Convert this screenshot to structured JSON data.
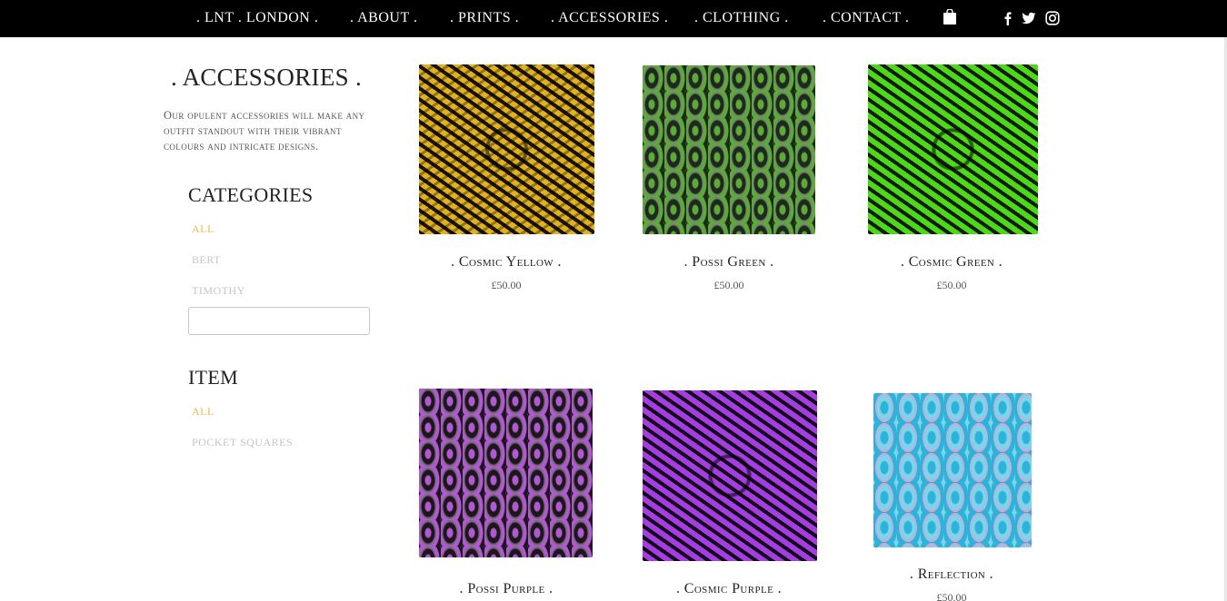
{
  "nav": {
    "items": [
      ". LNT . LONDON .",
      ". ABOUT .",
      ". PRINTS .",
      ". ACCESSORIES .",
      ". CLOTHING .",
      ". CONTACT ."
    ],
    "icons": [
      "shopping-bag-icon",
      "facebook-icon",
      "twitter-icon",
      "instagram-icon"
    ]
  },
  "sidebar": {
    "title": ". ACCESSORIES .",
    "description": "Our opulent accessories will make any outfit standout with their vibrant colours and intricate designs.",
    "categories_heading": "CATEGORIES",
    "categories": [
      "ALL",
      "BERT",
      "TIMOTHY"
    ],
    "search_value": "",
    "item_heading": "ITEM",
    "items": [
      "ALL",
      "POCKET SQUARES"
    ],
    "active_color": "#f2b84b"
  },
  "products": [
    {
      "name": ". Cosmic Yellow .",
      "price": "£50.00"
    },
    {
      "name": ". Possi Green .",
      "price": "£50.00"
    },
    {
      "name": ". Cosmic Green .",
      "price": "£50.00"
    },
    {
      "name": ". Possi Purple .",
      "price": ""
    },
    {
      "name": ". Cosmic Purple .",
      "price": ""
    },
    {
      "name": ". Reflection .",
      "price": "£50.00"
    }
  ]
}
